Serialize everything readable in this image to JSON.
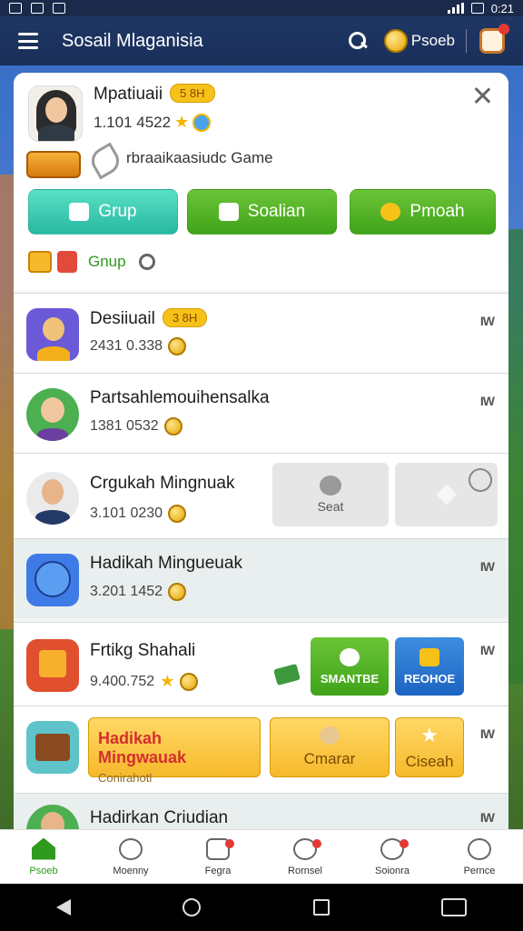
{
  "status_bar": {
    "time": "0:21"
  },
  "app_bar": {
    "title": "Sosail Mlaganisia",
    "coin_label": "Psoeb"
  },
  "profile": {
    "name": "Mpatiuaii",
    "badge": "5 8H",
    "stats": "1.101 4522",
    "subtitle": "rbraaikaasiudc Game",
    "buttons": {
      "grup": "Grup",
      "soalian": "Soalian",
      "pmoah": "Pmoah"
    },
    "grup_label": "Gnup"
  },
  "list": [
    {
      "name": "Desiiuail",
      "badge": "3 8H",
      "stats": "2431 0.338"
    },
    {
      "name": "Partsahlemouihensalka",
      "stats": "1381 0532"
    },
    {
      "name": "Crgukah Mingnuak",
      "stats": "3.101 0230",
      "seat_label": "Seat"
    },
    {
      "name": "Hadikah Mingueuak",
      "stats": "3.201 1452"
    },
    {
      "name": "Frtikg Shahali",
      "stats": "9.400.752",
      "btn1": "SMANTBE",
      "btn2": "REOHOE"
    },
    {
      "banner_title": "Hadikah Mingwauak",
      "banner_sub": "Conirahotl",
      "btn1": "Cmarar",
      "btn2": "Ciseah"
    },
    {
      "name": "Hadirkan Criudian"
    }
  ],
  "bottom_nav": [
    {
      "label": "Psoeb",
      "icon": "home-icon"
    },
    {
      "label": "Moenny",
      "icon": "helmet-icon"
    },
    {
      "label": "Fegra",
      "icon": "list-icon"
    },
    {
      "label": "Rornsel",
      "icon": "person-pin-icon"
    },
    {
      "label": "Soionra",
      "icon": "controller-icon"
    },
    {
      "label": "Pernce",
      "icon": "person-icon"
    }
  ],
  "colors": {
    "app_bar": "#1f3766",
    "accent_green": "#3fa31a",
    "accent_teal": "#29b8a2",
    "accent_blue": "#1c64c2",
    "badge_yellow": "#f6c21a"
  }
}
